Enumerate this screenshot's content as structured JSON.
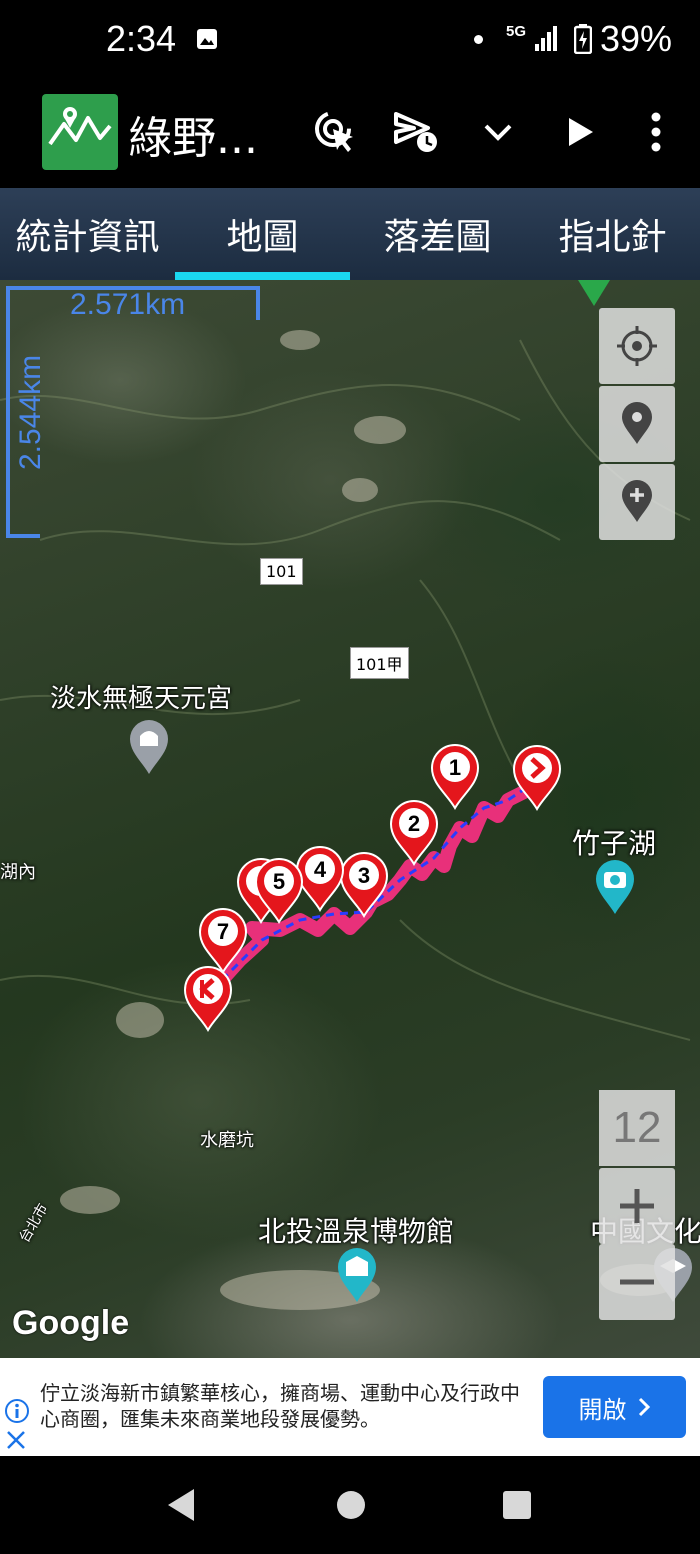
{
  "status_bar": {
    "time": "2:34",
    "network": "5G",
    "battery": "39%"
  },
  "app_bar": {
    "title": "綠野...",
    "actions": [
      "touch-target-icon",
      "send-schedule-icon",
      "chevron-down-icon",
      "play-icon",
      "more-vert-icon"
    ]
  },
  "tabs": [
    {
      "label": "統計資訊",
      "active": false
    },
    {
      "label": "地圖",
      "active": true
    },
    {
      "label": "落差圖",
      "active": false
    },
    {
      "label": "指北針",
      "active": false
    }
  ],
  "map": {
    "scale_horizontal": "2.571km",
    "scale_vertical": "2.544km",
    "roads": [
      "101",
      "101甲"
    ],
    "places": [
      {
        "name": "淡水無極天元宮"
      },
      {
        "name": "竹子湖"
      },
      {
        "name": "湖內"
      },
      {
        "name": "水磨坑"
      },
      {
        "name": "北投溫泉博物館"
      },
      {
        "name": "中國文化"
      },
      {
        "name": "台北市"
      }
    ],
    "waypoints": [
      "1",
      "2",
      "3",
      "4",
      "5",
      "7"
    ],
    "zoom_level": "12",
    "attribution": "Google",
    "colors": {
      "route": "#e8307a",
      "track": "#2a3cff",
      "pin": "#e4161c"
    }
  },
  "ad": {
    "text": "佇立淡海新市鎮繁華核心，擁商場、運動中心及行政中心商圈，匯集未來商業地段發展優勢。",
    "button_label": "開啟"
  }
}
